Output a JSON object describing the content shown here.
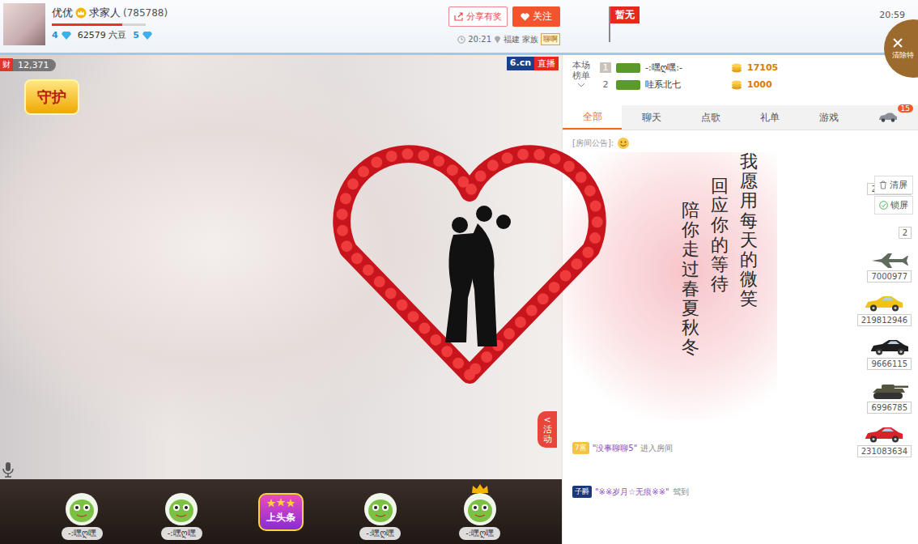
{
  "header": {
    "name": "优优",
    "tagline": "求家人",
    "room_id": "(785788)",
    "level": 0.75,
    "level_left": "4",
    "beans": "62579 六豆",
    "level_right": "5",
    "share_button": "分享有奖",
    "follow_button": "关注",
    "time": "20:21",
    "location": "福建",
    "family_label": "家族",
    "family_badge": "聊啊",
    "flag_label": "暂无",
    "clock": "20:59",
    "clear_button": "清除特"
  },
  "video": {
    "wealth_badge": "财",
    "viewers": "12,371",
    "guard_badge": "守护",
    "site_logo": "6.cn",
    "live_label": "直播",
    "activity_arrow": "<",
    "activity_label": "活动"
  },
  "gift_animation": {
    "lines": [
      "我愿用每天的微笑",
      "回应你的等待",
      "陪你走过春夏秋冬"
    ]
  },
  "bottom_strip": [
    {
      "label": "-:嘿ღ嘿",
      "kind": "avatar",
      "crowned": false
    },
    {
      "label": "-:嘿ღ嘿",
      "kind": "avatar",
      "crowned": false
    },
    {
      "label": "上头条",
      "kind": "headline",
      "crowned": false
    },
    {
      "label": "-:嘿ღ嘿",
      "kind": "avatar",
      "crowned": false
    },
    {
      "label": "-:嘿ღ嘿",
      "kind": "avatar",
      "crowned": true
    }
  ],
  "ranking": {
    "title": "本场榜单",
    "rows": [
      {
        "rank": "1",
        "name": "-:嘿ღ嘿:-",
        "amount": "17105",
        "selected": true
      },
      {
        "rank": "2",
        "name": "哇系北七",
        "amount": "1000",
        "selected": false
      }
    ]
  },
  "tabs": [
    {
      "label": "全部",
      "selected": true
    },
    {
      "label": "聊天",
      "selected": false
    },
    {
      "label": "点歌",
      "selected": false
    },
    {
      "label": "礼单",
      "selected": false
    },
    {
      "label": "游戏",
      "selected": false
    }
  ],
  "car_tab": {
    "badge": "15"
  },
  "chat": {
    "notice": "[房间公告]:",
    "side_buttons": [
      "清屏",
      "锁屏"
    ],
    "rows": [
      {
        "message": null,
        "gift": {
          "kind": "none",
          "color": "#999999",
          "amount": "2017526"
        }
      },
      {
        "message": null,
        "gift": {
          "kind": "none",
          "color": "#999999",
          "amount": "2"
        }
      },
      {
        "message": null,
        "gift": {
          "kind": "plane",
          "color": "#5f6b5c",
          "amount": "7000977"
        }
      },
      {
        "message": null,
        "gift": {
          "kind": "car",
          "color": "#f2c218",
          "amount": "219812946"
        }
      },
      {
        "message": null,
        "gift": {
          "kind": "car",
          "color": "#1e1e1e",
          "amount": "9666115"
        }
      },
      {
        "message": null,
        "gift": {
          "kind": "tank",
          "color": "#55553f",
          "amount": "6996785"
        }
      },
      {
        "message": {
          "badge": "7富",
          "badge_color": "#f3c343",
          "name": "\"没事聊聊5\"",
          "action": "进入房间"
        },
        "gift": {
          "kind": "car",
          "color": "#d8232a",
          "amount": "231083634"
        }
      },
      {
        "message": {
          "badge": "子爵",
          "badge_color": "#1d3778",
          "name": "\"※※岁月☆无痕※※\"",
          "action": "驾到"
        },
        "gift": null
      }
    ]
  }
}
